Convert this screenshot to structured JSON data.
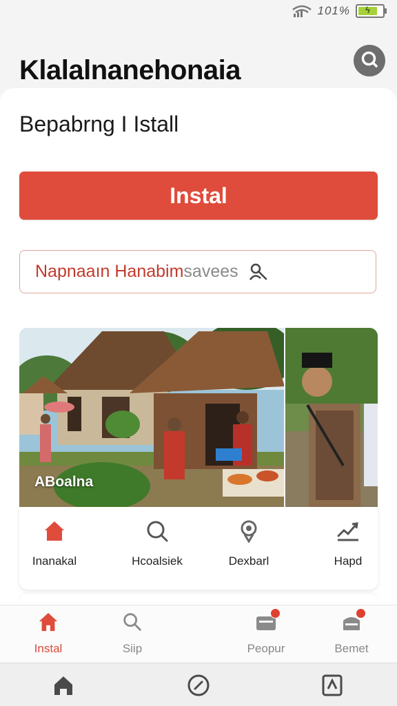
{
  "status_bar": {
    "battery_text": "101%",
    "battery_level": 0.9,
    "signal_icon": "signal-wifi-icon"
  },
  "header": {
    "title": "Klalalnanehonaia",
    "search_icon": "search-icon"
  },
  "subtitle": "Bepabrng I Istall",
  "install_button": {
    "label": "Instal",
    "color": "#df4c3b"
  },
  "search": {
    "value": "Napnaaın Hanabim",
    "placeholder": "savees",
    "icon": "search-person-icon"
  },
  "photo": {
    "caption": "ABoalna"
  },
  "categories": [
    {
      "label": "Inanakal",
      "icon": "home-icon"
    },
    {
      "label": "Hcoalsiek",
      "icon": "search-icon"
    },
    {
      "label": "Dexbarl",
      "icon": "location-pin-icon"
    },
    {
      "label": "Hapd",
      "icon": "chart-icon"
    }
  ],
  "bottom_nav": [
    {
      "label": "Instal",
      "icon": "home-icon",
      "active": true
    },
    {
      "label": "Siip",
      "icon": "search-icon",
      "active": false
    },
    {
      "label": "Peopur",
      "icon": "inbox-icon",
      "active": false,
      "badge": true
    },
    {
      "label": "Bemet",
      "icon": "tray-icon",
      "active": false,
      "badge": true
    }
  ],
  "system_nav": [
    "home-icon",
    "compass-icon",
    "app-icon"
  ],
  "colors": {
    "accent": "#df4c3b",
    "background": "#f4f4f4",
    "surface": "#ffffff"
  }
}
